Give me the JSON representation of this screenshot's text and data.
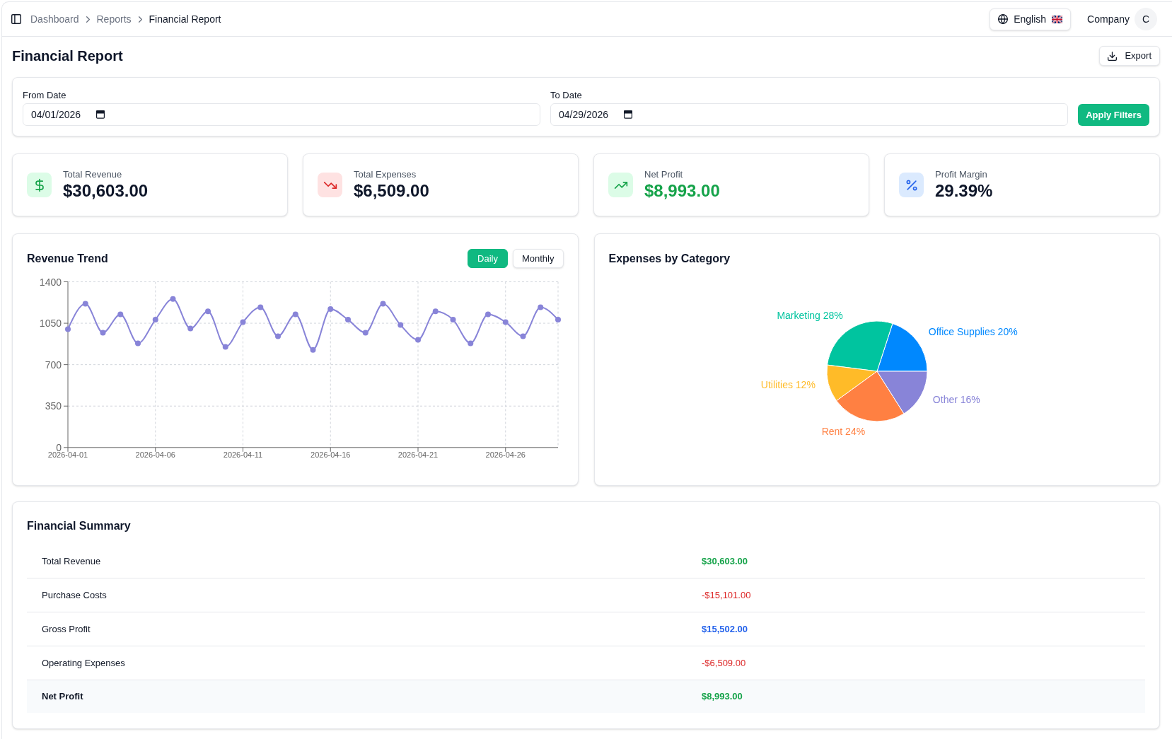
{
  "topbar": {
    "breadcrumb": [
      {
        "label": "Dashboard",
        "current": false
      },
      {
        "label": "Reports",
        "current": false
      },
      {
        "label": "Financial Report",
        "current": true
      }
    ],
    "language": {
      "label": "English"
    },
    "account": {
      "name": "Company",
      "avatar_initial": "C"
    }
  },
  "page": {
    "title": "Financial Report",
    "export_button": "Export"
  },
  "filters": {
    "fields": [
      {
        "label": "From Date",
        "value": "04/01/2026"
      },
      {
        "label": "To Date",
        "value": "04/29/2026"
      }
    ],
    "apply_button": "Apply Filters"
  },
  "stats": [
    {
      "kind": "revenue",
      "label": "Total Revenue",
      "value": "$30,603.00"
    },
    {
      "kind": "expenses",
      "label": "Total Expenses",
      "value": "$6,509.00"
    },
    {
      "kind": "profit",
      "label": "Net Profit",
      "value": "$8,993.00"
    },
    {
      "kind": "margin",
      "label": "Profit Margin",
      "value": "29.39%"
    }
  ],
  "revenue_trend": {
    "title": "Revenue Trend",
    "tabs": [
      {
        "label": "Daily",
        "selected": true
      },
      {
        "label": "Monthly",
        "selected": false
      }
    ],
    "chart_data": {
      "type": "line",
      "categories": [
        "2026-04-01",
        null,
        null,
        null,
        null,
        "2026-04-06",
        null,
        null,
        null,
        null,
        "2026-04-11",
        null,
        null,
        null,
        null,
        "2026-04-16",
        null,
        null,
        null,
        null,
        "2026-04-21",
        null,
        null,
        null,
        null,
        "2026-04-26",
        null,
        null,
        null
      ],
      "series": [
        {
          "color": "#8884d8",
          "marker": "circle",
          "values": [
            1000,
            1215,
            970,
            1125,
            880,
            1080,
            1255,
            1005,
            1150,
            850,
            1060,
            1185,
            940,
            1125,
            825,
            1170,
            1080,
            970,
            1215,
            1035,
            910,
            1150,
            1080,
            880,
            1125,
            1060,
            940,
            1185,
            1080
          ]
        }
      ],
      "grid": true,
      "ylim": [
        0,
        1400
      ],
      "yticks": [
        0,
        350,
        700,
        1050,
        1400
      ]
    }
  },
  "expenses_by_category": {
    "title": "Expenses by Category",
    "chart_data": {
      "type": "pie",
      "values": [
        20,
        28,
        12,
        24,
        16
      ],
      "colors": [
        "#0088fe",
        "#00c49f",
        "#ffbb28",
        "#ff8042",
        "#8884d8"
      ],
      "value_labels": [
        "Office Supplies 20%",
        "Marketing 28%",
        "Utilities 12%",
        "Rent 24%",
        "Other 16%"
      ]
    }
  },
  "financial_summary": {
    "title": "Financial Summary",
    "rows": [
      {
        "kind": "revenue",
        "label": "Total Revenue",
        "value": "$30,603.00"
      },
      {
        "kind": "cost",
        "label": "Purchase Costs",
        "value": "-$15,101.00"
      },
      {
        "kind": "subtotal",
        "label": "Gross Profit",
        "value": "$15,502.00"
      },
      {
        "kind": "cost",
        "label": "Operating Expenses",
        "value": "-$6,509.00"
      },
      {
        "kind": "total",
        "label": "Net Profit",
        "value": "$8,993.00"
      }
    ]
  }
}
